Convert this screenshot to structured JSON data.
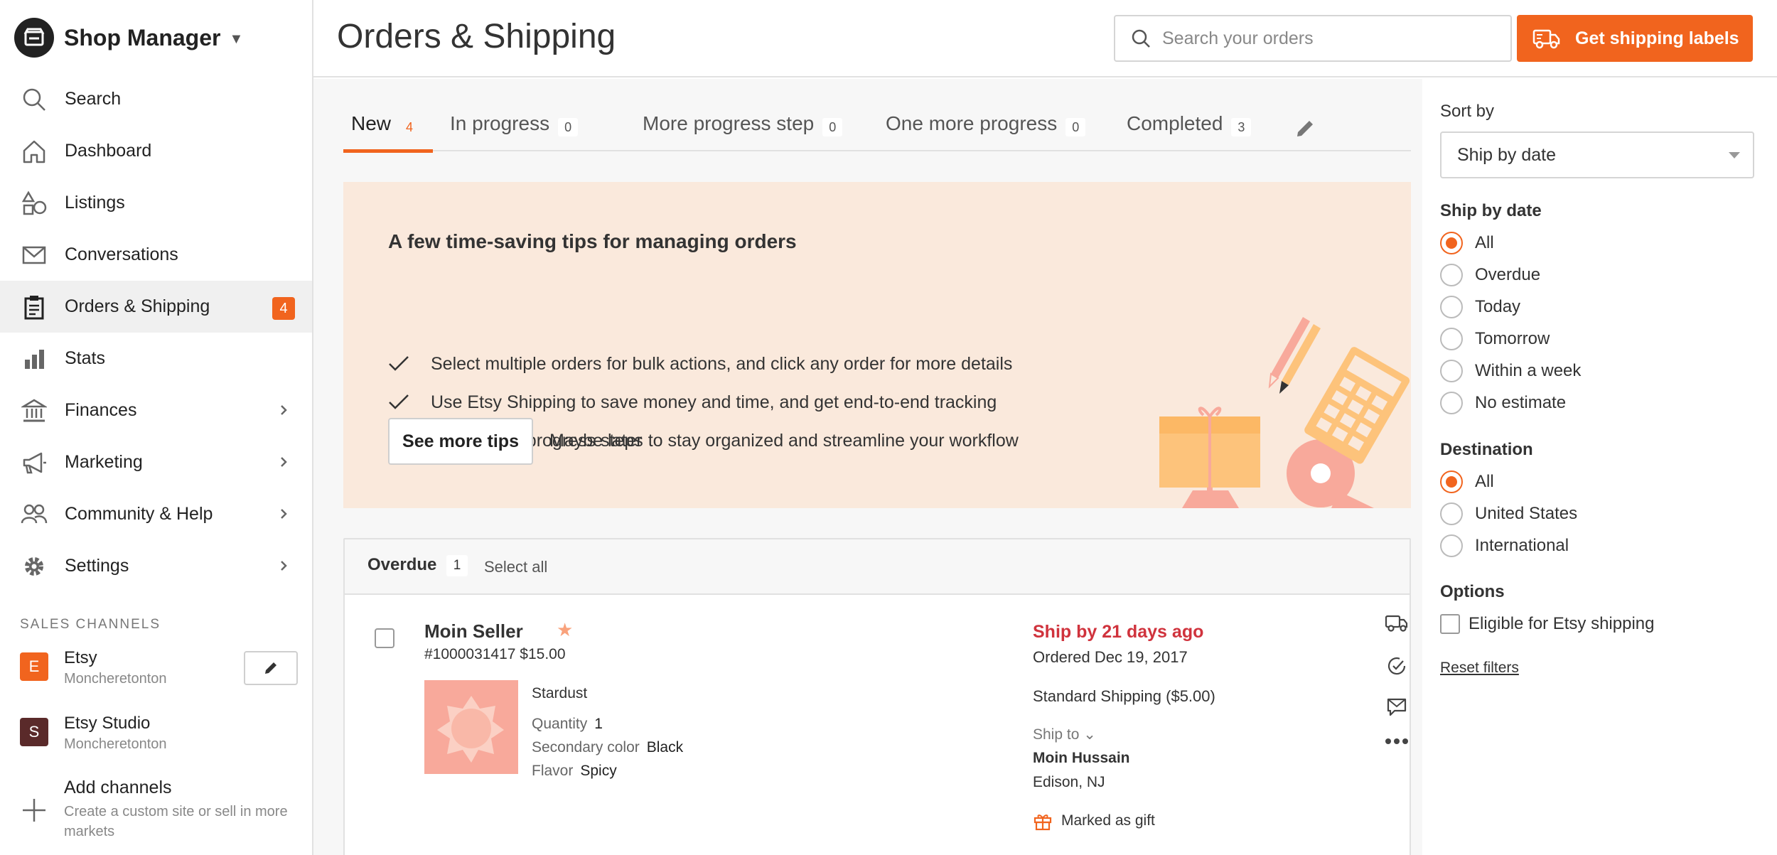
{
  "app": {
    "title": "Shop Manager",
    "accent": "#f1641e"
  },
  "sidebar": {
    "items": [
      {
        "label": "Search",
        "icon": "search-icon"
      },
      {
        "label": "Dashboard",
        "icon": "home-icon"
      },
      {
        "label": "Listings",
        "icon": "shapes-icon"
      },
      {
        "label": "Conversations",
        "icon": "mail-icon"
      },
      {
        "label": "Orders & Shipping",
        "icon": "clipboard-icon",
        "badge": "4",
        "active": true
      },
      {
        "label": "Stats",
        "icon": "bar-chart-icon"
      },
      {
        "label": "Finances",
        "icon": "bank-icon"
      },
      {
        "label": "Marketing",
        "icon": "megaphone-icon"
      },
      {
        "label": "Community & Help",
        "icon": "people-icon"
      },
      {
        "label": "Settings",
        "icon": "gear-icon"
      }
    ],
    "channels_header": "SALES CHANNELS",
    "channels": [
      {
        "letter": "E",
        "name": "Etsy",
        "sub": "Moncheretonton",
        "color": "#f1641e"
      },
      {
        "letter": "S",
        "name": "Etsy Studio",
        "sub": "Moncheretonton",
        "color": "#5a2a2a"
      }
    ],
    "add_channels": {
      "title": "Add channels",
      "sub": "Create a custom site or sell in more markets"
    }
  },
  "header": {
    "title": "Orders & Shipping",
    "search_placeholder": "Search your orders",
    "ship_button": "Get shipping labels"
  },
  "tabs": [
    {
      "label": "New",
      "count": "4",
      "active": true
    },
    {
      "label": "In progress",
      "count": "0"
    },
    {
      "label": "More progress step",
      "count": "0"
    },
    {
      "label": "One more progress",
      "count": "0"
    },
    {
      "label": "Completed",
      "count": "3"
    }
  ],
  "tips": {
    "title": "A few time-saving tips for managing orders",
    "items": [
      "Select multiple orders for bulk actions, and click any order for more details",
      "Use Etsy Shipping to save money and time, and get end-to-end tracking",
      "Create new progress steps to stay organized and streamline your workflow"
    ],
    "see_more": "See more tips",
    "maybe_later": "Maybe later"
  },
  "orders": {
    "group_title": "Overdue",
    "group_count": "1",
    "select_all": "Select all",
    "order": {
      "buyer": "Moin Seller",
      "star": "★",
      "id_price": "#1000031417  $15.00",
      "item": "Stardust",
      "attrs": [
        {
          "label": "Quantity",
          "value": "1"
        },
        {
          "label": "Secondary color",
          "value": "Black"
        },
        {
          "label": "Flavor",
          "value": "Spicy"
        }
      ],
      "ship_by": "Ship by 21 days ago",
      "ordered": "Ordered Dec 19, 2017",
      "shipping": "Standard Shipping  ($5.00)",
      "ship_to_label": "Ship to ⌄",
      "ship_to_name": "Moin Hussain",
      "ship_to_location": "Edison, NJ",
      "gift": "Marked as gift"
    }
  },
  "filters": {
    "sort_label": "Sort by",
    "sort_value": "Ship by date",
    "ship_by_label": "Ship by date",
    "ship_by_options": [
      "All",
      "Overdue",
      "Today",
      "Tomorrow",
      "Within a week",
      "No estimate"
    ],
    "destination_label": "Destination",
    "destination_options": [
      "All",
      "United States",
      "International"
    ],
    "options_label": "Options",
    "etsy_shipping_option": "Eligible for Etsy shipping",
    "reset": "Reset filters"
  }
}
